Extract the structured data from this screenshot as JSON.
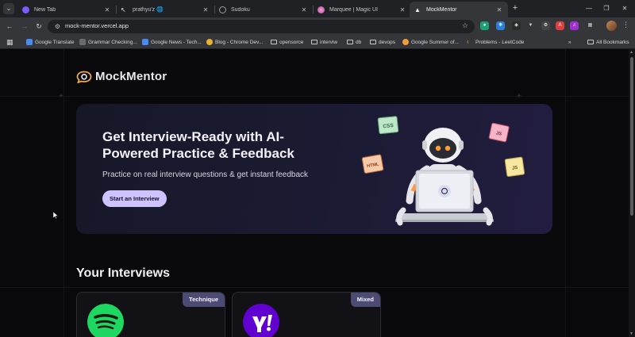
{
  "browser": {
    "tabs": [
      {
        "label": "New Tab",
        "icon": "new-tab-favicon",
        "color": "#7c5cff"
      },
      {
        "label": "prathyu'z 🌐",
        "icon": "cursor-favicon",
        "color": "#e8e8e8"
      },
      {
        "label": "Sudoku",
        "icon": "globe-favicon",
        "color": "#9aa0a6"
      },
      {
        "label": "Marquee | Magic UI",
        "icon": "magic-ui-favicon",
        "color": "#e26ab6"
      },
      {
        "label": "MockMentor",
        "icon": "triangle-favicon",
        "color": "#f1f1f1"
      }
    ],
    "url": "mock-mentor.vercel.app",
    "bookmarks": [
      {
        "label": "Google Translate",
        "icon": "translate-icon",
        "color": "#4a8af4"
      },
      {
        "label": "Grammar Checking...",
        "icon": "grammar-icon",
        "color": "#6b6b6b"
      },
      {
        "label": "Google News - Tech...",
        "icon": "news-icon",
        "color": "#4a8af4"
      },
      {
        "label": "Blog - Chrome Dev...",
        "icon": "chrome-icon",
        "color": "#e8b22e"
      },
      {
        "label": "opensorce",
        "icon": "folder-icon"
      },
      {
        "label": "interviw",
        "icon": "folder-icon"
      },
      {
        "label": "db",
        "icon": "folder-icon"
      },
      {
        "label": "devops",
        "icon": "folder-icon"
      },
      {
        "label": "Google Summer of...",
        "icon": "gsoc-icon",
        "color": "#f29d38"
      },
      {
        "label": "Problems - LeetCode",
        "icon": "leetcode-icon",
        "color": "#f0a035"
      }
    ],
    "all_bookmarks": "All Bookmarks"
  },
  "app": {
    "brand": "MockMentor",
    "accent": "#cfc3ff",
    "hero": {
      "title": "Get Interview-Ready with AI-Powered Practice & Feedback",
      "subtitle": "Practice on real interview questions & get instant feedback",
      "cta": "Start an Interview",
      "badges": [
        "CSS",
        "HTML",
        "JS",
        "JS"
      ]
    },
    "section_title": "Your Interviews",
    "cards": [
      {
        "badge": "Technique",
        "logo": "spotify-logo",
        "logo_color": "#1ed760"
      },
      {
        "badge": "Mixed",
        "logo": "yahoo-logo",
        "logo_color": "#6001d2"
      }
    ]
  }
}
